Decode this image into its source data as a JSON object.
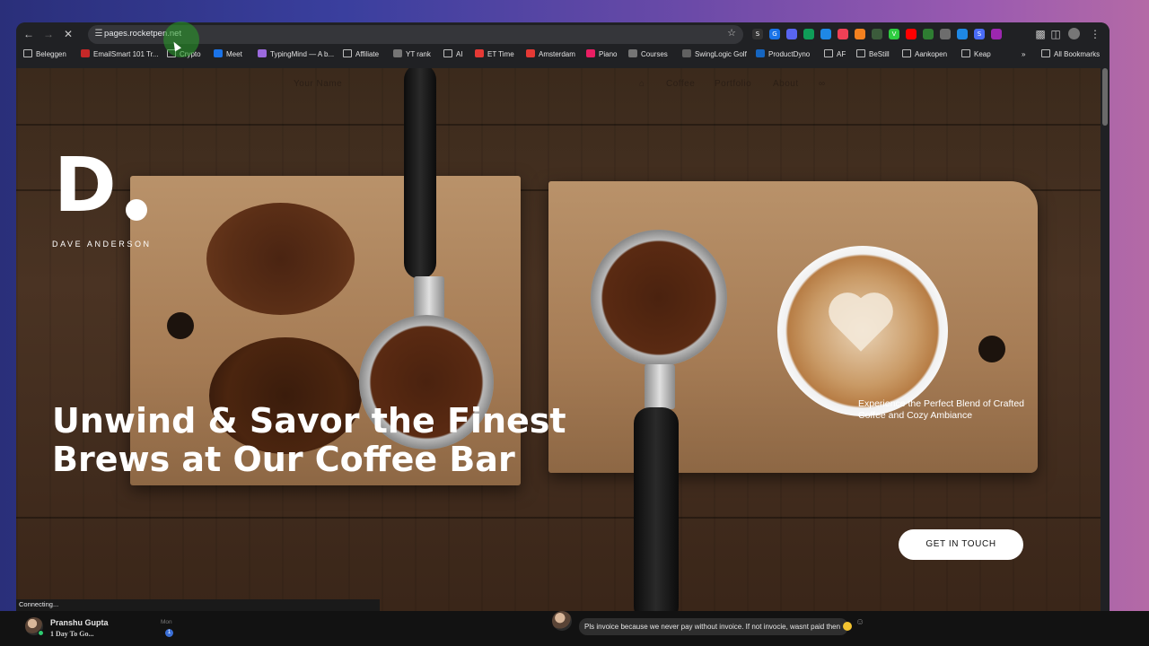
{
  "browser": {
    "url": "pages.rocketpen.net",
    "status": "Connecting...",
    "extensions": [
      {
        "name": "s-extension-icon",
        "letter": "S",
        "color": "#333333"
      },
      {
        "name": "g-extension-icon",
        "letter": "G",
        "color": "#1a73e8"
      },
      {
        "name": "discord-extension-icon",
        "letter": "",
        "color": "#5865f2"
      },
      {
        "name": "sheets-extension-icon",
        "letter": "",
        "color": "#0f9d58"
      },
      {
        "name": "dropper-extension-icon",
        "letter": "",
        "color": "#1e88e5"
      },
      {
        "name": "pocket-extension-icon",
        "letter": "",
        "color": "#ef4056"
      },
      {
        "name": "orange-extension-icon",
        "letter": "",
        "color": "#f4811f"
      },
      {
        "name": "quill-extension-icon",
        "letter": "",
        "color": "#3b5b3b"
      },
      {
        "name": "v-extension-icon",
        "letter": "V",
        "color": "#2ecc40"
      },
      {
        "name": "youtube-extension-icon",
        "letter": "",
        "color": "#ff0000"
      },
      {
        "name": "check-extension-icon",
        "letter": "",
        "color": "#2e7d32"
      },
      {
        "name": "globe-extension-icon",
        "letter": "",
        "color": "#6d6d6d"
      },
      {
        "name": "download-extension-icon",
        "letter": "",
        "color": "#1e88e5"
      },
      {
        "name": "s-blue-extension-icon",
        "letter": "S",
        "color": "#4a6cf7"
      },
      {
        "name": "pinwheel-extension-icon",
        "letter": "",
        "color": "#9c27b0"
      }
    ],
    "bookmarks": [
      {
        "label": "Beleggen",
        "icon": "folder-icon",
        "fav": false
      },
      {
        "label": "EmailSmart 101 Tr...",
        "icon": "emailsmart-favicon",
        "fav": true,
        "color": "#c62828"
      },
      {
        "label": "Crypto",
        "icon": "folder-icon",
        "fav": false
      },
      {
        "label": "Meet",
        "icon": "meet-favicon",
        "fav": true,
        "color": "#1a73e8"
      },
      {
        "label": "TypingMind — A b...",
        "icon": "typingmind-favicon",
        "fav": true,
        "color": "#9c6ade"
      },
      {
        "label": "Affiliate",
        "icon": "folder-icon",
        "fav": false
      },
      {
        "label": "YT rank",
        "icon": "globe-favicon",
        "fav": true,
        "color": "#757575"
      },
      {
        "label": "AI",
        "icon": "folder-icon",
        "fav": false
      },
      {
        "label": "ET Time",
        "icon": "et-favicon",
        "fav": true,
        "color": "#e53935"
      },
      {
        "label": "Amsterdam",
        "icon": "amsterdam-favicon",
        "fav": true,
        "color": "#e53935"
      },
      {
        "label": "Piano",
        "icon": "piano-favicon",
        "fav": true,
        "color": "#e91e63"
      },
      {
        "label": "Courses",
        "icon": "courses-favicon",
        "fav": true,
        "color": "#757575"
      },
      {
        "label": "SwingLogic Golf",
        "icon": "swinglogic-favicon",
        "fav": true,
        "color": "#616161"
      },
      {
        "label": "ProductDyno",
        "icon": "productdyno-favicon",
        "fav": true,
        "color": "#1565c0"
      },
      {
        "label": "AF",
        "icon": "folder-icon",
        "fav": false
      },
      {
        "label": "BeStill",
        "icon": "folder-icon",
        "fav": false
      },
      {
        "label": "Aankopen",
        "icon": "folder-icon",
        "fav": false
      },
      {
        "label": "Keap",
        "icon": "folder-icon",
        "fav": false
      }
    ],
    "more": "»",
    "all_bookmarks": "All Bookmarks"
  },
  "site": {
    "nav": {
      "brand": "Your Name",
      "home_icon": "home-icon",
      "links": [
        "Coffee",
        "Portfolio",
        "About"
      ],
      "share_icon": "share-icon"
    },
    "logo_letter": "D",
    "logo_name": "DAVE ANDERSON",
    "hero_title": "Unwind & Savor the Finest Brews at Our Coffee Bar",
    "hero_subtitle": "Experience the Perfect Blend of Crafted Coffee and Cozy Ambiance",
    "cta": "GET IN TOUCH"
  },
  "notification": {
    "sender": "Pranshu Gupta",
    "preview": "1 Day To Go...",
    "day": "Mon",
    "unread": "1",
    "message": "Pls invoice because we never pay without invoice. If not invocie, wasnt paid then"
  },
  "colors": {
    "accent_green": "#2ecc71",
    "cta_bg": "#ffffff",
    "wood": "#3b2a1c"
  }
}
